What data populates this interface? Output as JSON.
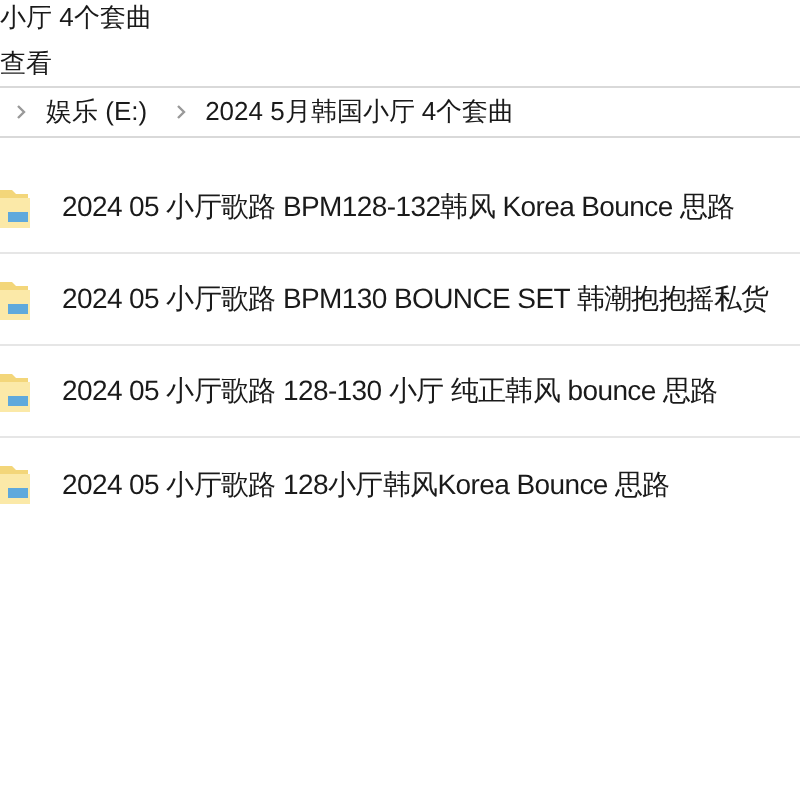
{
  "window": {
    "title": "小厅 4个套曲"
  },
  "menu": [
    "查看"
  ],
  "address_bar": {
    "crumbs": [
      "娱乐 (E:)",
      "2024 5月韩国小厅 4个套曲"
    ]
  },
  "files": [
    {
      "name": "2024 05 小厅歌路  BPM128-132韩风 Korea Bounce 思路",
      "kind": "folder"
    },
    {
      "name": "2024 05 小厅歌路  BPM130 BOUNCE SET 韩潮抱抱摇私货",
      "kind": "folder"
    },
    {
      "name": "2024 05 小厅歌路 128-130 小厅 纯正韩风  bounce 思路",
      "kind": "folder"
    },
    {
      "name": "2024 05 小厅歌路 128小厅韩风Korea Bounce 思路",
      "kind": "folder"
    }
  ]
}
